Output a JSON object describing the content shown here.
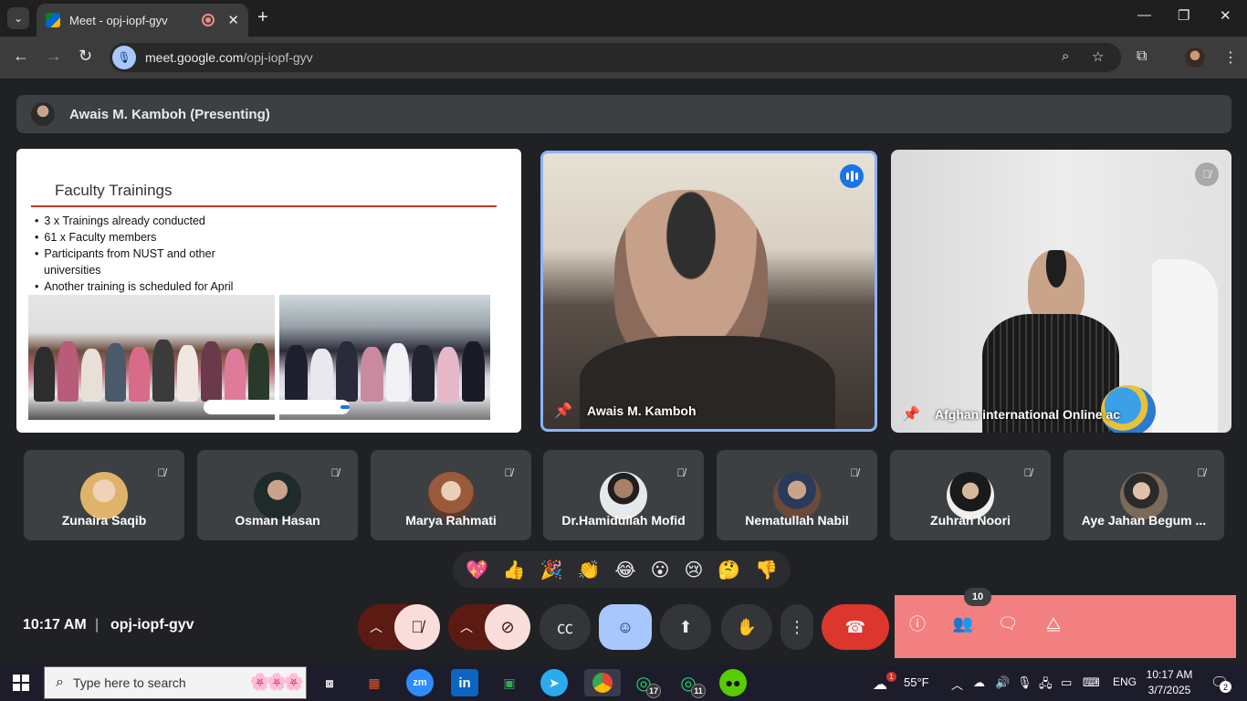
{
  "browser": {
    "tab_title": "Meet - opj-iopf-gyv",
    "url_host": "meet.google.com",
    "url_path": "/opj-iopf-gyv",
    "new_tab": "+",
    "close_tab": "✕",
    "minimize": "—",
    "maximize": "❐",
    "close_window": "✕"
  },
  "meet": {
    "presenter_bar": "Awais M. Kamboh (Presenting)",
    "slide": {
      "title": "Faculty Trainings",
      "bullets": [
        "3 x Trainings already conducted",
        "61 x Faculty members",
        "Participants from NUST and other universities",
        "Another training is scheduled for April"
      ]
    },
    "main_tiles": [
      {
        "name": "Awais M. Kamboh",
        "speaking": true
      },
      {
        "name": "Afghan international Online ac",
        "muted": true
      }
    ],
    "participants": [
      {
        "name": "Zunaira Saqib",
        "avatar_color": "#e0b36a"
      },
      {
        "name": "Osman Hasan",
        "avatar_color": "#3b5a4a"
      },
      {
        "name": "Marya Rahmati",
        "avatar_color": "#9c5a3c"
      },
      {
        "name": "Dr.Hamidullah Mofid",
        "avatar_color": "#e8e8e8"
      },
      {
        "name": "Nematullah Nabil",
        "avatar_color": "#6b4a3a"
      },
      {
        "name": "Zuhrah Noori",
        "avatar_color": "#f0efec"
      },
      {
        "name": "Aye Jahan Begum ...",
        "avatar_color": "#7a6a5a"
      }
    ],
    "reactions": [
      "💖",
      "👍",
      "🎉",
      "👏",
      "😂",
      "😮",
      "😢",
      "🤔",
      "👎"
    ],
    "time": "10:17 AM",
    "separator": "|",
    "meeting_code": "opj-iopf-gyv",
    "people_count": "10"
  },
  "taskbar": {
    "search_placeholder": "Type here to search",
    "weather": "55°F",
    "language": "ENG",
    "time": "10:17 AM",
    "date": "3/7/2025",
    "whatsapp1_badge": "17",
    "whatsapp2_badge": "11",
    "notification_count": "2",
    "weather_badge": "1",
    "zoom_label": "zm",
    "linkedin_label": "in"
  },
  "colors": {
    "accent": "#8ab4f8",
    "end_call": "#dc362e",
    "side_panel": "#f28080",
    "background": "#202124"
  }
}
